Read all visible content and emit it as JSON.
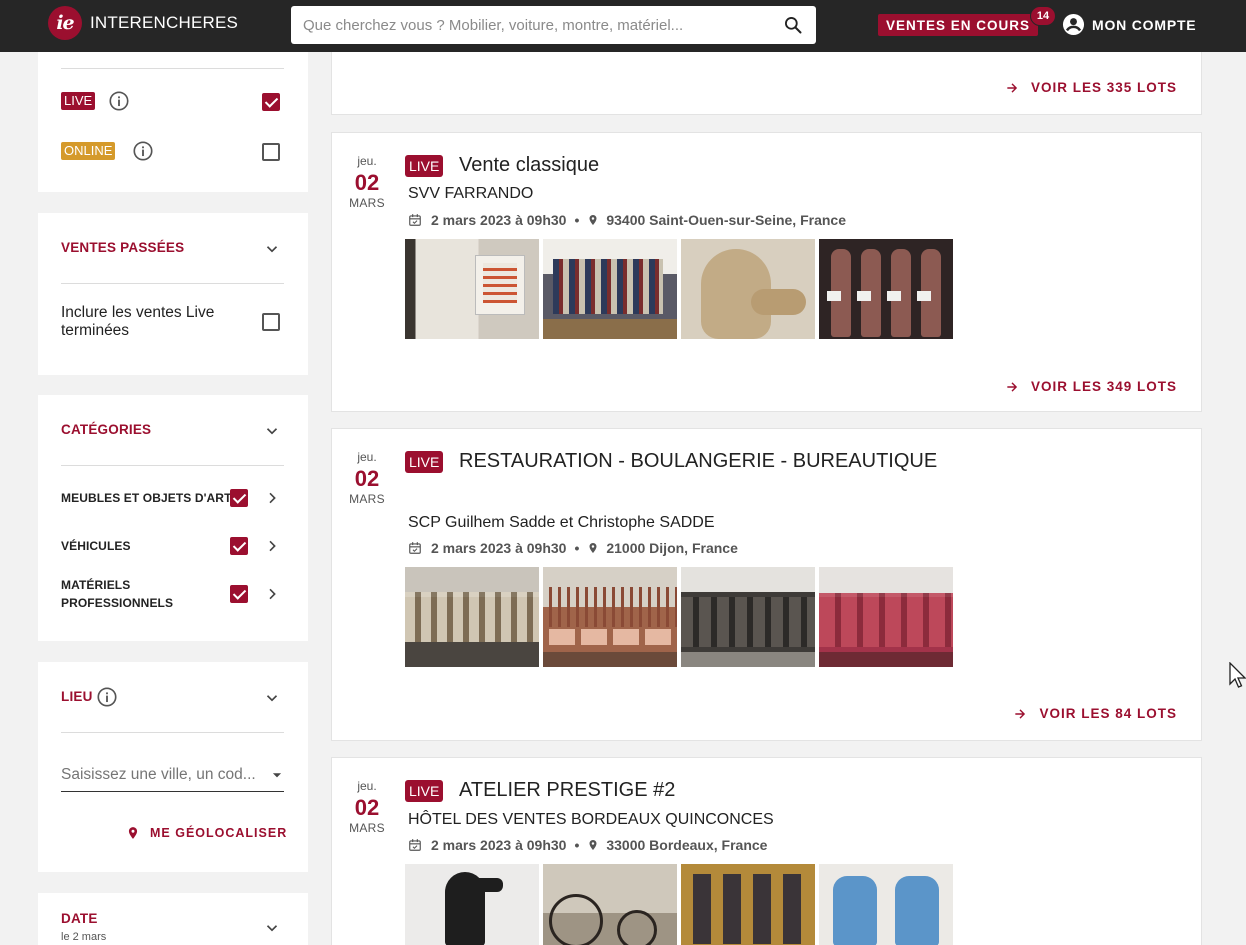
{
  "header": {
    "brand": "INTERENCHERES",
    "logo_mark": "ie",
    "search_placeholder": "Que cherchez vous ? Mobilier, voiture, montre, matériel...",
    "live_sales_label": "VENTES EN COURS",
    "live_sales_count": "14",
    "account_label": "MON COMPTE",
    "icons": {
      "search": "search-icon",
      "account": "account-circle-icon"
    }
  },
  "sidebar": {
    "type_filters": [
      {
        "label": "LIVE",
        "checked": true,
        "color": "#9b0f2f"
      },
      {
        "label": "ONLINE",
        "checked": false,
        "color": "#d59a2b"
      }
    ],
    "past_sales": {
      "title": "VENTES PASSÉES",
      "include_label": "Inclure les ventes Live terminées",
      "include_checked": false
    },
    "categories": {
      "title": "CATÉGORIES",
      "items": [
        {
          "label": "MEUBLES ET OBJETS D'ART",
          "checked": true
        },
        {
          "label": "VÉHICULES",
          "checked": true
        },
        {
          "label": "MATÉRIELS PROFESSIONNELS",
          "checked": true
        }
      ]
    },
    "location": {
      "title": "LIEU",
      "input_placeholder": "Saisissez une ville, un cod...",
      "geolocate_label": "ME GÉOLOCALISER"
    },
    "date": {
      "title": "DATE",
      "subtitle": "le 2 mars"
    }
  },
  "sales": [
    {
      "see_lots": "VOIR LES 335 LOTS"
    },
    {
      "dow": "jeu.",
      "day": "02",
      "month": "MARS",
      "tag": "LIVE",
      "title": "Vente classique",
      "house": "SVV FARRANDO",
      "datetime": "2 mars 2023 à 09h30",
      "location": "93400 Saint-Ouen-sur-Seine, France",
      "see_lots": "VOIR LES 349 LOTS"
    },
    {
      "dow": "jeu.",
      "day": "02",
      "month": "MARS",
      "tag": "LIVE",
      "title": "RESTAURATION - BOULANGERIE - BUREAUTIQUE",
      "house": "SCP Guilhem Sadde et Christophe SADDE",
      "datetime": "2 mars 2023 à 09h30",
      "location": "21000 Dijon, France",
      "see_lots": "VOIR LES 84 LOTS"
    },
    {
      "dow": "jeu.",
      "day": "02",
      "month": "MARS",
      "tag": "LIVE",
      "title": "ATELIER PRESTIGE #2",
      "house": "HÔTEL DES VENTES BORDEAUX QUINCONCES",
      "datetime": "2 mars 2023 à 09h30",
      "location": "33000 Bordeaux, France"
    }
  ],
  "colors": {
    "brand": "#9b0f2f",
    "online": "#d59a2b",
    "header_bg": "#262626"
  }
}
